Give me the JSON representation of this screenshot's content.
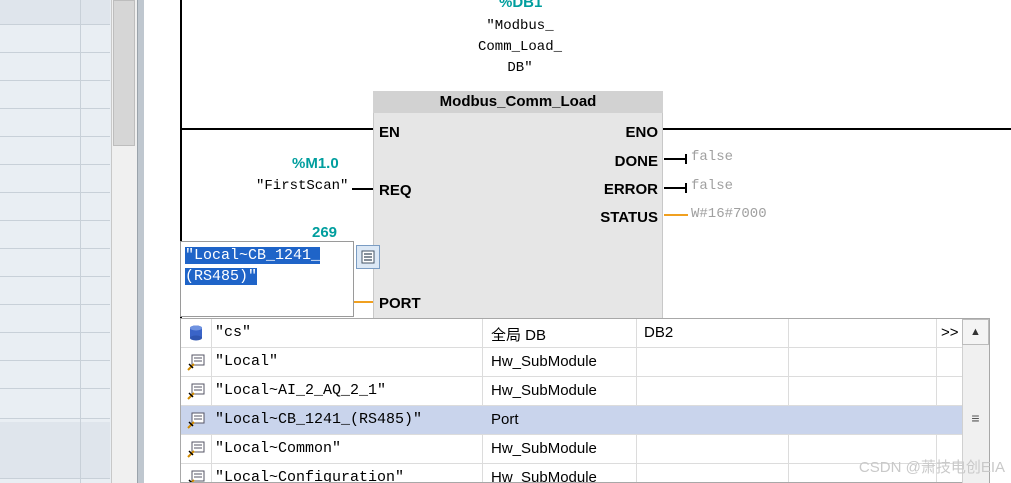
{
  "block": {
    "instance_address": "%DB1",
    "instance_name": "\"Modbus_ Comm_Load_ DB\"",
    "instance_name_lines": [
      "\"Modbus_",
      "Comm_Load_",
      "DB\""
    ],
    "title": "Modbus_Comm_Load",
    "pins_in": {
      "en": "EN",
      "req": "REQ",
      "port": "PORT"
    },
    "pins_out": {
      "eno": "ENO",
      "done": "DONE",
      "error": "ERROR",
      "status": "STATUS"
    }
  },
  "params": {
    "req_address": "%M1.0",
    "req_tag": "\"FirstScan\"",
    "done_value": "false",
    "error_value": "false",
    "status_value": "W#16#7000",
    "port_value": "269"
  },
  "editor": {
    "line1": "\"Local~CB_1241_",
    "line2": "(RS485)\"",
    "button_icon": "list-icon"
  },
  "dropdown": {
    "expand_label": ">>",
    "rows": [
      {
        "name": "\"cs\"",
        "type": "全局 DB",
        "number": "DB2",
        "icon": "database-icon",
        "selected": false
      },
      {
        "name": "\"Local\"",
        "type": "Hw_SubModule",
        "number": "",
        "icon": "hw-module-icon",
        "selected": false
      },
      {
        "name": "\"Local~AI_2_AQ_2_1\"",
        "type": "Hw_SubModule",
        "number": "",
        "icon": "hw-module-icon",
        "selected": false
      },
      {
        "name": "\"Local~CB_1241_(RS485)\"",
        "type": "Port",
        "number": "",
        "icon": "hw-module-icon",
        "selected": true
      },
      {
        "name": "\"Local~Common\"",
        "type": "Hw_SubModule",
        "number": "",
        "icon": "hw-module-icon",
        "selected": false
      },
      {
        "name": "\"Local~Configuration\"",
        "type": "Hw_SubModule",
        "number": "",
        "icon": "hw-module-icon",
        "selected": false
      }
    ]
  },
  "watermark": "CSDN @萧技电创EIA",
  "colors": {
    "teal": "#009e9e",
    "orange": "#f0a020",
    "selection": "#1f64c8",
    "row_selected": "#c9d4ec"
  }
}
